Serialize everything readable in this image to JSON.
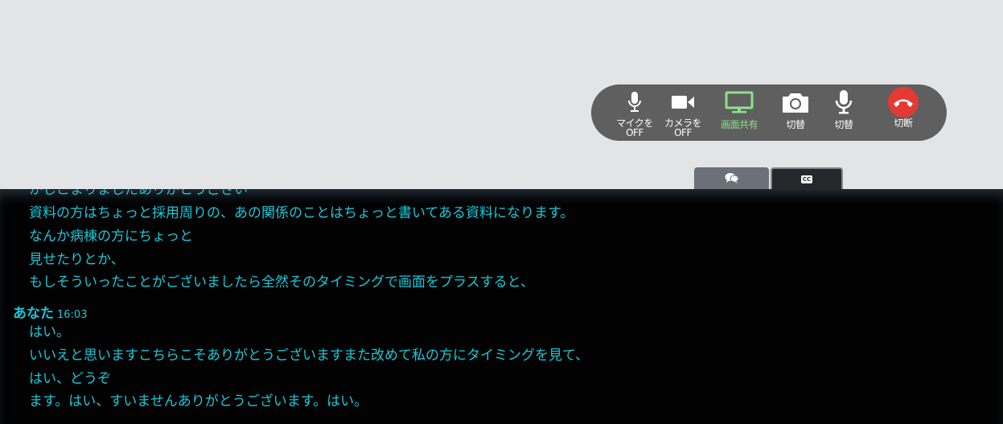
{
  "toolbar": {
    "mic": {
      "label": "マイクを\nOFF",
      "icon": "microphone-icon"
    },
    "camera": {
      "label": "カメラを\nOFF",
      "icon": "video-camera-icon"
    },
    "screen_share": {
      "label": "画面共有",
      "icon": "monitor-icon",
      "color": "#8be28b"
    },
    "switch_camera": {
      "label": "切替",
      "icon": "camera-icon"
    },
    "switch_mic": {
      "label": "切替",
      "icon": "microphone-icon"
    },
    "hangup": {
      "label": "切断",
      "icon": "phone-hangup-icon",
      "color": "#e53935"
    }
  },
  "tabs": {
    "chat": {
      "icon": "chat-bubbles-icon"
    },
    "captions": {
      "icon": "cc-icon",
      "text": "CC"
    }
  },
  "captions": {
    "lines_before": [
      "かしこまりましたありがとうござい",
      "資料の方はちょっと採用周りの、あの関係のことはちょっと書いてある資料になります。",
      "なんか病棟の方にちょっと",
      "見せたりとか、",
      "もしそういったことがございましたら全然そのタイミングで画面をプラスすると、"
    ],
    "speaker": {
      "name": "あなた",
      "time": "16:03"
    },
    "lines_after": [
      "はい。",
      "いいえと思いますこちらこそありがとうございますまた改めて私の方にタイミングを見て、",
      "はい、どうぞ",
      "ます。はい、すいませんありがとうございます。はい。"
    ],
    "text_color": "#19c8d8"
  }
}
